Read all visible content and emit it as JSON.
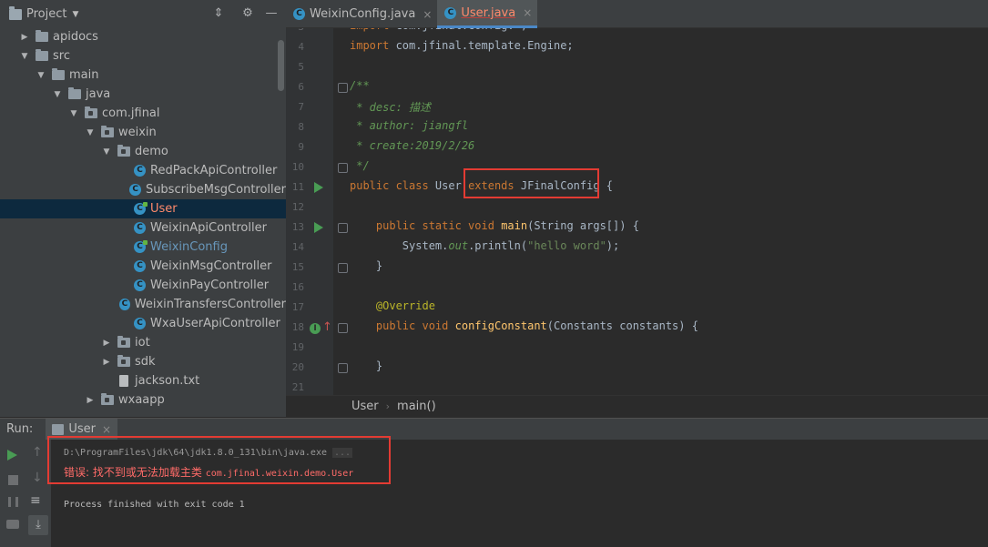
{
  "project": {
    "title": "Project",
    "tree": [
      {
        "label": "apidocs",
        "kind": "folder",
        "arrow": "▶",
        "indent": 0
      },
      {
        "label": "src",
        "kind": "folder",
        "arrow": "▼",
        "indent": 0
      },
      {
        "label": "main",
        "kind": "folder",
        "arrow": "▼",
        "indent": 1
      },
      {
        "label": "java",
        "kind": "folder",
        "arrow": "▼",
        "indent": 2
      },
      {
        "label": "com.jfinal",
        "kind": "package",
        "arrow": "▼",
        "indent": 3
      },
      {
        "label": "weixin",
        "kind": "package",
        "arrow": "▼",
        "indent": 4
      },
      {
        "label": "demo",
        "kind": "package",
        "arrow": "▼",
        "indent": 5
      },
      {
        "label": "RedPackApiController",
        "kind": "class",
        "arrow": "",
        "indent": 6
      },
      {
        "label": "SubscribeMsgController",
        "kind": "class",
        "arrow": "",
        "indent": 6
      },
      {
        "label": "User",
        "kind": "class-run",
        "arrow": "",
        "indent": 6,
        "selected": true,
        "color": "red"
      },
      {
        "label": "WeixinApiController",
        "kind": "class",
        "arrow": "",
        "indent": 6
      },
      {
        "label": "WeixinConfig",
        "kind": "class-run",
        "arrow": "",
        "indent": 6,
        "color": "blue"
      },
      {
        "label": "WeixinMsgController",
        "kind": "class",
        "arrow": "",
        "indent": 6
      },
      {
        "label": "WeixinPayController",
        "kind": "class",
        "arrow": "",
        "indent": 6
      },
      {
        "label": "WeixinTransfersController",
        "kind": "class",
        "arrow": "",
        "indent": 6
      },
      {
        "label": "WxaUserApiController",
        "kind": "class",
        "arrow": "",
        "indent": 6
      },
      {
        "label": "iot",
        "kind": "package",
        "arrow": "▶",
        "indent": 5
      },
      {
        "label": "sdk",
        "kind": "package",
        "arrow": "▶",
        "indent": 5
      },
      {
        "label": "jackson.txt",
        "kind": "file",
        "arrow": "",
        "indent": 5
      },
      {
        "label": "wxaapp",
        "kind": "package",
        "arrow": "▶",
        "indent": 4
      }
    ]
  },
  "editor": {
    "tabs": [
      {
        "label": "WeixinConfig.java",
        "active": false
      },
      {
        "label": "User.java",
        "active": true
      }
    ],
    "lines": [
      {
        "n": "3",
        "html": "<span class=\"kw\">import</span> com.jfinal.config.*;"
      },
      {
        "n": "4",
        "html": "<span class=\"kw\">import</span> com.jfinal.template.Engine;"
      },
      {
        "n": "5",
        "html": ""
      },
      {
        "n": "6",
        "html": "<span class=\"cmt\">/**</span>"
      },
      {
        "n": "7",
        "html": "<span class=\"cmt\"> * desc: 描述</span>"
      },
      {
        "n": "8",
        "html": "<span class=\"cmt\"> * author: jiangfl</span>"
      },
      {
        "n": "9",
        "html": "<span class=\"cmt\"> * create:2019/2/26</span>"
      },
      {
        "n": "10",
        "html": "<span class=\"cmt\"> */</span>"
      },
      {
        "n": "11",
        "html": "<span class=\"kw\">public class</span> User <span class=\"kw\">extends</span> JFinalConfig {"
      },
      {
        "n": "12",
        "html": ""
      },
      {
        "n": "13",
        "html": "    <span class=\"kw\">public static void</span> <span class=\"fn\">main</span>(String args[]) {"
      },
      {
        "n": "14",
        "html": "        System.<span class=\"cmt\">out</span>.println(<span class=\"str\">\"hello word\"</span>);"
      },
      {
        "n": "15",
        "html": "    }"
      },
      {
        "n": "16",
        "html": ""
      },
      {
        "n": "17",
        "html": "    <span class=\"ann\">@Override</span>"
      },
      {
        "n": "18",
        "html": "    <span class=\"kw\">public void</span> <span class=\"fn\">configConstant</span>(Constants constants) {"
      },
      {
        "n": "19",
        "html": ""
      },
      {
        "n": "20",
        "html": "    }"
      },
      {
        "n": "21",
        "html": ""
      }
    ],
    "breadcrumbs": [
      "User",
      "main()"
    ]
  },
  "run": {
    "title": "Run:",
    "tab_label": "User",
    "console": {
      "cmd": "D:\\ProgramFiles\\jdk\\64\\jdk1.8.0_131\\bin\\java.exe",
      "cmd_dots": "...",
      "error_prefix": "错误: 找不到或无法加载主类",
      "error_class": "com.jfinal.weixin.demo.User",
      "finished": "Process finished with exit code 1"
    }
  },
  "colors": {
    "highlight_box": "#e33b33",
    "selection": "#0d293e",
    "keyword": "#cc7832",
    "error": "#ff6b68"
  }
}
